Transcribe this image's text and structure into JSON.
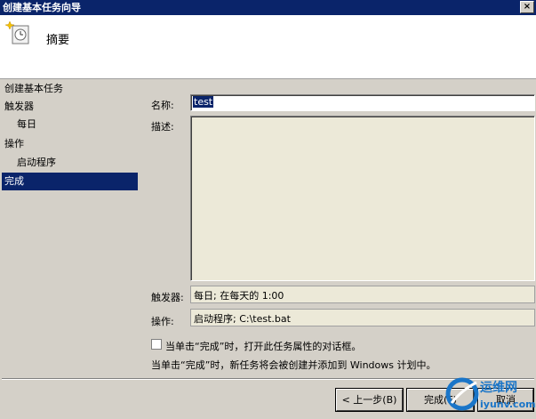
{
  "window": {
    "title": "创建基本任务向导",
    "close_glyph": "×"
  },
  "header": {
    "title": "摘要",
    "icon": "scheduled-task-clock-icon"
  },
  "nav": {
    "items": [
      {
        "label": "创建基本任务"
      },
      {
        "label": "触发器"
      },
      {
        "label": "每日"
      },
      {
        "label": "操作"
      },
      {
        "label": "启动程序"
      },
      {
        "label": "完成"
      }
    ]
  },
  "form": {
    "name_label": "名称:",
    "name_value": "test",
    "desc_label": "描述:",
    "desc_value": "",
    "trigger_label": "触发器:",
    "trigger_value": "每日; 在每天的 1:00",
    "action_label": "操作:",
    "action_value": "启动程序; C:\\test.bat",
    "open_props_label": "当单击“完成”时，打开此任务属性的对话框。",
    "open_props_checked": false,
    "info_text": "当单击“完成”时，新任务将会被创建并添加到 Windows 计划中。"
  },
  "buttons": {
    "back": "< 上一步(B)",
    "finish": "完成(F)",
    "cancel": "取消"
  },
  "watermark": {
    "brand": "运维网",
    "site": "iyunv.com"
  },
  "colors": {
    "selection": "#0a246a",
    "accent": "#0a246a",
    "watermark": "#1a75c8"
  }
}
